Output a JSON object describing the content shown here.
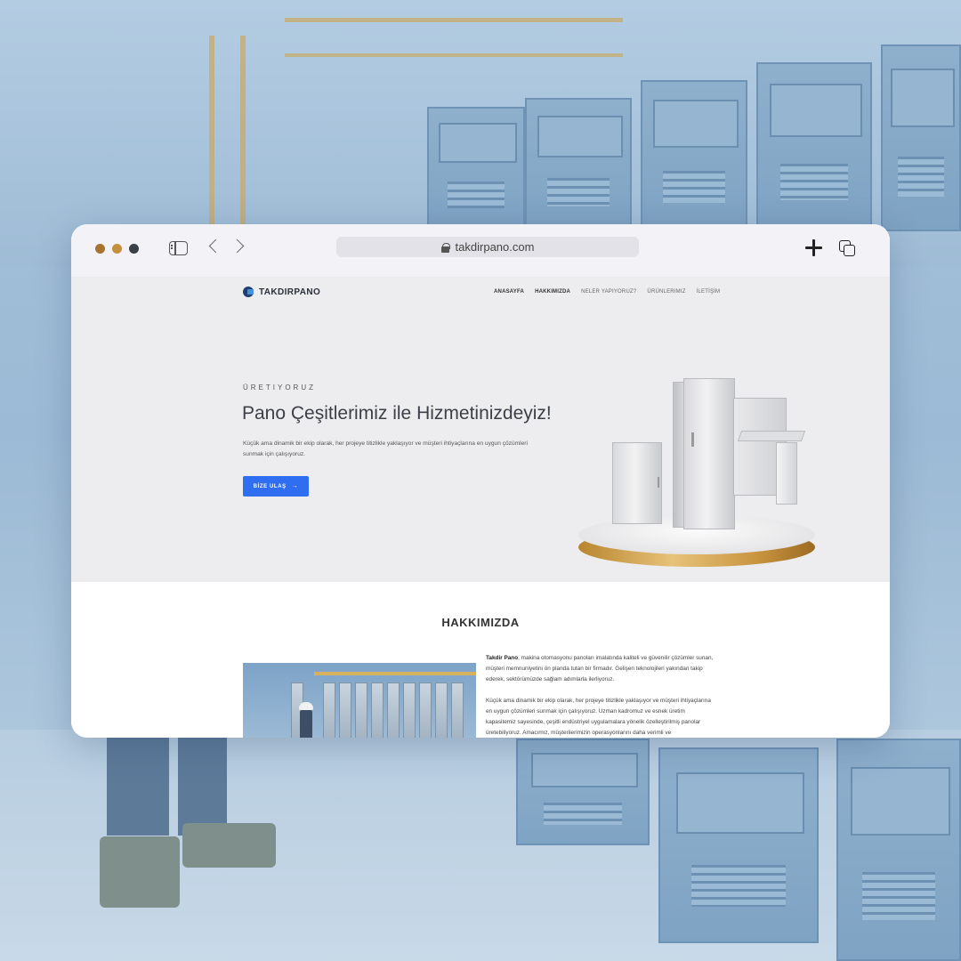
{
  "browser": {
    "url": "takdirpano.com"
  },
  "site": {
    "logo_text": "TAKDIRPANO",
    "menu": [
      "ANASAYFA",
      "HAKKIMIZDA",
      "NELER YAPIYORUZ?",
      "ÜRÜNLERIMIZ",
      "İLETİŞİM"
    ],
    "hero": {
      "eyebrow": "ÜRETIYORUZ",
      "title": "Pano Çeşitlerimiz ile Hizmetinizdeyiz!",
      "description": "Küçük ama dinamik bir ekip olarak, her projeye titizlikle yaklaşıyor ve müşteri ihtiyaçlarına en uygun çözümleri sunmak için çalışıyoruz.",
      "cta_label": "BİZE ULAŞ",
      "cta_icon": "arrow-right-icon"
    },
    "about": {
      "title": "HAKKIMIZDA",
      "brand": "Takdir Pano",
      "paragraph1_rest": ", makina otomasyonu panoları imalatında kaliteli ve güvenilir çözümler sunan, müşteri memnuniyetini ön planda tutan bir firmadır. Gelişen teknolojileri yakından takip ederek, sektörümüzde sağlam adımlarla ilerliyoruz.",
      "paragraph2": "Küçük ama dinamik bir ekip olarak, her projeye titizlikle yaklaşıyor ve müşteri ihtiyaçlarına en uygun çözümleri sunmak için çalışıyoruz. Uzman kadromuz ve esnek üretim kapasitemiz sayesinde, çeşitli endüstriyel uygulamalara yönelik özelleştirilmiş panolar üretebiliyoruz. Amacımız, müşterilerimizin operasyonlarını daha verimli ve"
    }
  },
  "colors": {
    "accent": "#2f6ef0",
    "hero_bg": "#ededf0",
    "chrome_bg": "#f3f2f7"
  }
}
